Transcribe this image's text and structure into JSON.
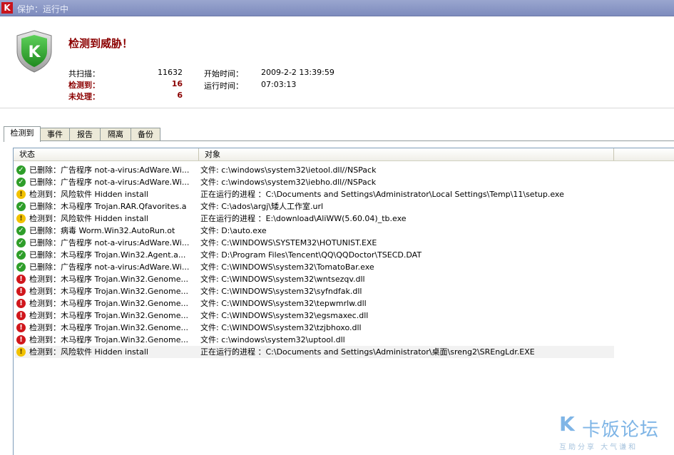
{
  "window": {
    "title": "保护：运行中",
    "logo_letter": "K"
  },
  "header": {
    "alert_title": "检测到威胁！",
    "shield_letter": "K",
    "stats": {
      "scanned_label": "共扫描：",
      "scanned_value": "11632",
      "detected_label": "检测到：",
      "detected_value": "16",
      "unhandled_label": "未处理：",
      "unhandled_value": "6"
    },
    "times": {
      "start_label": "开始时间：",
      "start_value": "2009-2-2 13:39:59",
      "run_label": "运行时间：",
      "run_value": "07:03:13"
    }
  },
  "tabs": [
    "检测到",
    "事件",
    "报告",
    "隔离",
    "备份"
  ],
  "list": {
    "columns": [
      "状态",
      "对象"
    ],
    "rows": [
      {
        "icon": "ok",
        "status": "已删除：广告程序 not-a-virus:AdWare.Wi...",
        "object": "文件: c:\\windows\\system32\\ietool.dll//NSPack"
      },
      {
        "icon": "ok",
        "status": "已删除：广告程序 not-a-virus:AdWare.Wi...",
        "object": "文件: c:\\windows\\system32\\iebho.dll//NSPack"
      },
      {
        "icon": "warn",
        "status": "检测到：风险软件 Hidden install",
        "object": "正在运行的进程  ：C:\\Documents and Settings\\Administrator\\Local Settings\\Temp\\11\\setup.exe"
      },
      {
        "icon": "ok",
        "status": "已删除：木马程序 Trojan.RAR.Qfavorites.a",
        "object": "文件: C:\\ados\\argj\\矮人工作室.url"
      },
      {
        "icon": "warn",
        "status": "检测到：风险软件 Hidden install",
        "object": "正在运行的进程  ：E:\\download\\AliWW(5.60.04)_tb.exe"
      },
      {
        "icon": "ok",
        "status": "已删除：病毒 Worm.Win32.AutoRun.ot",
        "object": "文件: D:\\auto.exe"
      },
      {
        "icon": "ok",
        "status": "已删除：广告程序 not-a-virus:AdWare.Wi...",
        "object": "文件: C:\\WINDOWS\\SYSTEM32\\HOTUNIST.EXE"
      },
      {
        "icon": "ok",
        "status": "已删除：木马程序 Trojan.Win32.Agent.a...",
        "object": "文件: D:\\Program Files\\Tencent\\QQ\\QQDoctor\\TSECD.DAT"
      },
      {
        "icon": "ok",
        "status": "已删除：广告程序 not-a-virus:AdWare.Wi...",
        "object": "文件: C:\\WINDOWS\\system32\\TomatoBar.exe"
      },
      {
        "icon": "err",
        "status": "检测到：木马程序 Trojan.Win32.Genome...",
        "object": "文件: C:\\WINDOWS\\system32\\wntsezqv.dll"
      },
      {
        "icon": "err",
        "status": "检测到：木马程序 Trojan.Win32.Genome...",
        "object": "文件: C:\\WINDOWS\\system32\\syfndfak.dll"
      },
      {
        "icon": "err",
        "status": "检测到：木马程序 Trojan.Win32.Genome...",
        "object": "文件: C:\\WINDOWS\\system32\\tepwmrlw.dll"
      },
      {
        "icon": "err",
        "status": "检测到：木马程序 Trojan.Win32.Genome...",
        "object": "文件: C:\\WINDOWS\\system32\\egsmaxec.dll"
      },
      {
        "icon": "err",
        "status": "检测到：木马程序 Trojan.Win32.Genome...",
        "object": "文件: C:\\WINDOWS\\system32\\tzjbhoxo.dll"
      },
      {
        "icon": "err",
        "status": "检测到：木马程序 Trojan.Win32.Genome...",
        "object": "文件: c:\\windows\\system32\\uptool.dll"
      },
      {
        "icon": "warn",
        "status": "检测到：风险软件 Hidden install",
        "object": "正在运行的进程  ：C:\\Documents and Settings\\Administrator\\桌面\\sreng2\\SREngLdr.EXE"
      }
    ]
  },
  "watermark": {
    "letter": "K",
    "text": "卡饭论坛",
    "slogan": "互助分享  大气谦和"
  },
  "colors": {
    "accent_red": "#8b0000",
    "ok_green": "#2e9e2a",
    "warn_yellow": "#f2c200",
    "err_red": "#d0161c",
    "titlebar": "#8e9ac8"
  }
}
